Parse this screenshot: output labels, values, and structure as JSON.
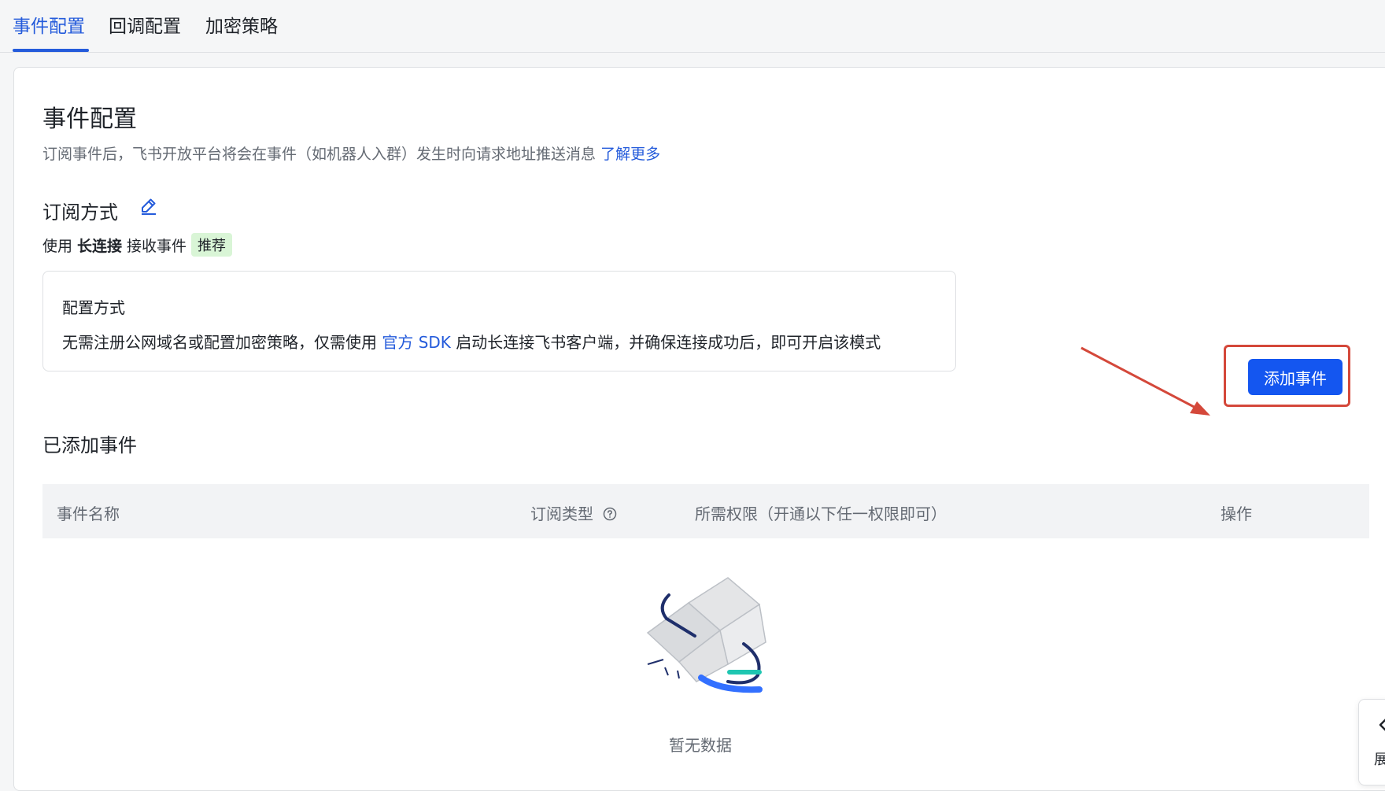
{
  "tabs": [
    {
      "label": "事件配置",
      "active": true
    },
    {
      "label": "回调配置",
      "active": false
    },
    {
      "label": "加密策略",
      "active": false
    }
  ],
  "page": {
    "title": "事件配置",
    "description": "订阅事件后，飞书开放平台将会在事件（如机器人入群）发生时向请求地址推送消息",
    "learn_more": "了解更多"
  },
  "subscription": {
    "title": "订阅方式",
    "edit_icon": "pencil-icon",
    "use_prefix": "使用",
    "use_mode": "长连接",
    "use_suffix": "接收事件",
    "tag": "推荐"
  },
  "config_box": {
    "title": "配置方式",
    "text_before": "无需注册公网域名或配置加密策略，仅需使用",
    "link": "官方 SDK",
    "text_after": "启动长连接飞书客户端，并确保连接成功后，即可开启该模式"
  },
  "added_events": {
    "title": "已添加事件",
    "add_button": "添加事件",
    "columns": [
      "事件名称",
      "订阅类型",
      "所需权限（开通以下任一权限即可）",
      "操作"
    ],
    "help_icon": "question-circle-icon",
    "empty_text": "暂无数据"
  },
  "side_float": {
    "icon": "chevron-left-icon",
    "label": "展"
  },
  "colors": {
    "accent": "#245bdb",
    "button": "#1456f0",
    "highlight": "#d4483a",
    "tag_bg": "#d9f5d6"
  }
}
